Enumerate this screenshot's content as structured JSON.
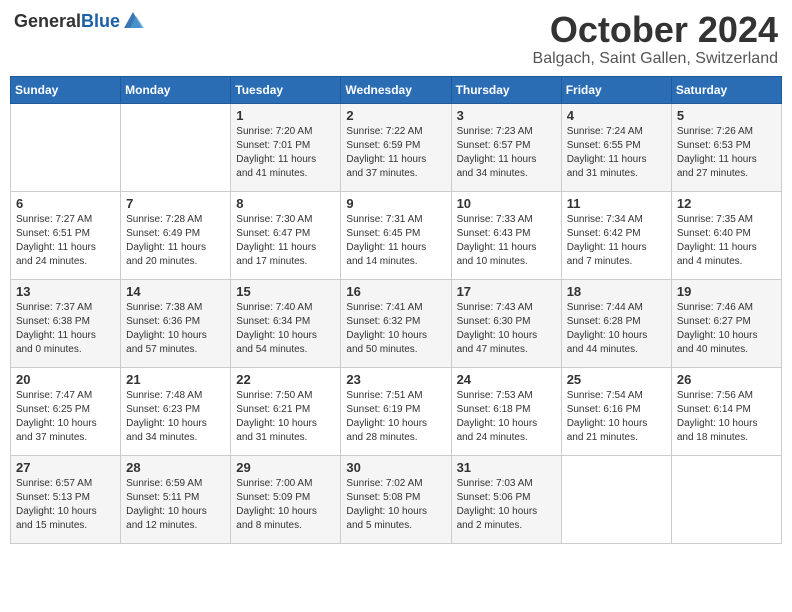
{
  "header": {
    "logo_general": "General",
    "logo_blue": "Blue",
    "month_title": "October 2024",
    "location": "Balgach, Saint Gallen, Switzerland"
  },
  "weekdays": [
    "Sunday",
    "Monday",
    "Tuesday",
    "Wednesday",
    "Thursday",
    "Friday",
    "Saturday"
  ],
  "weeks": [
    [
      {
        "day": "",
        "content": ""
      },
      {
        "day": "",
        "content": ""
      },
      {
        "day": "1",
        "content": "Sunrise: 7:20 AM\nSunset: 7:01 PM\nDaylight: 11 hours and 41 minutes."
      },
      {
        "day": "2",
        "content": "Sunrise: 7:22 AM\nSunset: 6:59 PM\nDaylight: 11 hours and 37 minutes."
      },
      {
        "day": "3",
        "content": "Sunrise: 7:23 AM\nSunset: 6:57 PM\nDaylight: 11 hours and 34 minutes."
      },
      {
        "day": "4",
        "content": "Sunrise: 7:24 AM\nSunset: 6:55 PM\nDaylight: 11 hours and 31 minutes."
      },
      {
        "day": "5",
        "content": "Sunrise: 7:26 AM\nSunset: 6:53 PM\nDaylight: 11 hours and 27 minutes."
      }
    ],
    [
      {
        "day": "6",
        "content": "Sunrise: 7:27 AM\nSunset: 6:51 PM\nDaylight: 11 hours and 24 minutes."
      },
      {
        "day": "7",
        "content": "Sunrise: 7:28 AM\nSunset: 6:49 PM\nDaylight: 11 hours and 20 minutes."
      },
      {
        "day": "8",
        "content": "Sunrise: 7:30 AM\nSunset: 6:47 PM\nDaylight: 11 hours and 17 minutes."
      },
      {
        "day": "9",
        "content": "Sunrise: 7:31 AM\nSunset: 6:45 PM\nDaylight: 11 hours and 14 minutes."
      },
      {
        "day": "10",
        "content": "Sunrise: 7:33 AM\nSunset: 6:43 PM\nDaylight: 11 hours and 10 minutes."
      },
      {
        "day": "11",
        "content": "Sunrise: 7:34 AM\nSunset: 6:42 PM\nDaylight: 11 hours and 7 minutes."
      },
      {
        "day": "12",
        "content": "Sunrise: 7:35 AM\nSunset: 6:40 PM\nDaylight: 11 hours and 4 minutes."
      }
    ],
    [
      {
        "day": "13",
        "content": "Sunrise: 7:37 AM\nSunset: 6:38 PM\nDaylight: 11 hours and 0 minutes."
      },
      {
        "day": "14",
        "content": "Sunrise: 7:38 AM\nSunset: 6:36 PM\nDaylight: 10 hours and 57 minutes."
      },
      {
        "day": "15",
        "content": "Sunrise: 7:40 AM\nSunset: 6:34 PM\nDaylight: 10 hours and 54 minutes."
      },
      {
        "day": "16",
        "content": "Sunrise: 7:41 AM\nSunset: 6:32 PM\nDaylight: 10 hours and 50 minutes."
      },
      {
        "day": "17",
        "content": "Sunrise: 7:43 AM\nSunset: 6:30 PM\nDaylight: 10 hours and 47 minutes."
      },
      {
        "day": "18",
        "content": "Sunrise: 7:44 AM\nSunset: 6:28 PM\nDaylight: 10 hours and 44 minutes."
      },
      {
        "day": "19",
        "content": "Sunrise: 7:46 AM\nSunset: 6:27 PM\nDaylight: 10 hours and 40 minutes."
      }
    ],
    [
      {
        "day": "20",
        "content": "Sunrise: 7:47 AM\nSunset: 6:25 PM\nDaylight: 10 hours and 37 minutes."
      },
      {
        "day": "21",
        "content": "Sunrise: 7:48 AM\nSunset: 6:23 PM\nDaylight: 10 hours and 34 minutes."
      },
      {
        "day": "22",
        "content": "Sunrise: 7:50 AM\nSunset: 6:21 PM\nDaylight: 10 hours and 31 minutes."
      },
      {
        "day": "23",
        "content": "Sunrise: 7:51 AM\nSunset: 6:19 PM\nDaylight: 10 hours and 28 minutes."
      },
      {
        "day": "24",
        "content": "Sunrise: 7:53 AM\nSunset: 6:18 PM\nDaylight: 10 hours and 24 minutes."
      },
      {
        "day": "25",
        "content": "Sunrise: 7:54 AM\nSunset: 6:16 PM\nDaylight: 10 hours and 21 minutes."
      },
      {
        "day": "26",
        "content": "Sunrise: 7:56 AM\nSunset: 6:14 PM\nDaylight: 10 hours and 18 minutes."
      }
    ],
    [
      {
        "day": "27",
        "content": "Sunrise: 6:57 AM\nSunset: 5:13 PM\nDaylight: 10 hours and 15 minutes."
      },
      {
        "day": "28",
        "content": "Sunrise: 6:59 AM\nSunset: 5:11 PM\nDaylight: 10 hours and 12 minutes."
      },
      {
        "day": "29",
        "content": "Sunrise: 7:00 AM\nSunset: 5:09 PM\nDaylight: 10 hours and 8 minutes."
      },
      {
        "day": "30",
        "content": "Sunrise: 7:02 AM\nSunset: 5:08 PM\nDaylight: 10 hours and 5 minutes."
      },
      {
        "day": "31",
        "content": "Sunrise: 7:03 AM\nSunset: 5:06 PM\nDaylight: 10 hours and 2 minutes."
      },
      {
        "day": "",
        "content": ""
      },
      {
        "day": "",
        "content": ""
      }
    ]
  ]
}
